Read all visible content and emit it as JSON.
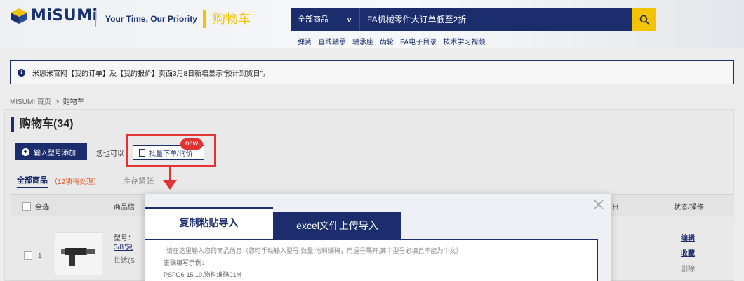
{
  "header": {
    "logo_text": "MiSUMi",
    "tagline": "Your Time, Our Priority",
    "cart_title": "购物车",
    "search": {
      "category": "全部商品",
      "query": "FA机械零件大订单低至2折"
    },
    "hot_links": [
      "弹簧",
      "直线轴承",
      "轴承座",
      "齿轮",
      "FA电子目录",
      "技术学习视频"
    ]
  },
  "notice": {
    "text": "米思米官网【我的订单】及【我的报价】页面3月8日新增显示“预计到货日”。"
  },
  "breadcrumb": {
    "home": "MISUMI 首页",
    "separator": ">",
    "current": "购物车"
  },
  "cart": {
    "heading": "购物车(34)",
    "add_button": "输入型号添加",
    "also_text": "您也可以",
    "bulk_button": "批量下单/询价",
    "new_badge": "new",
    "tabs": {
      "all": "全部商品",
      "pending": "（12项待处理）",
      "stock": "库存紧张"
    },
    "table": {
      "select_all": "全选",
      "col_name": "商品信",
      "col_date": "日",
      "col_status": "状态/操作"
    },
    "rows": [
      {
        "index": "1",
        "label": "型号：",
        "link": "3/8\"复",
        "brand": "世达(S",
        "actions": {
          "edit": "编辑",
          "favorite": "收藏",
          "delete": "删除"
        }
      }
    ]
  },
  "modal": {
    "tab_paste": "复制粘贴导入",
    "tab_excel": "excel文件上传导入",
    "placeholder": "请在这里输入您的商品信息（您可手动输入型号,数量,物料编码，用逗号隔开,其中型号必填且不能为中文）",
    "example_label": "正确填写示例：",
    "example_line": "PSFG6-15,10,物料编码01M"
  }
}
